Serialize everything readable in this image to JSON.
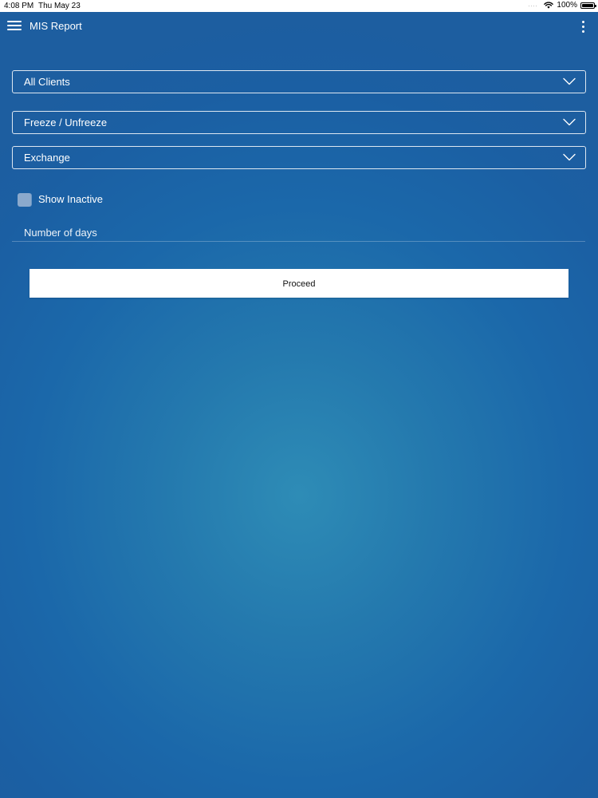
{
  "status_bar": {
    "time": "4:08 PM",
    "date": "Thu May 23",
    "signal_dots": "....",
    "battery": "100%",
    "battery_level": 1.0,
    "wifi_icon": "wifi-icon"
  },
  "app_bar": {
    "title": "MIS Report",
    "menu_icon": "hamburger-menu-icon",
    "more_icon": "more-vertical-icon"
  },
  "form": {
    "clients_dropdown": {
      "selected": "All Clients",
      "icon": "chevron-down-icon"
    },
    "freeze_dropdown": {
      "selected": "Freeze / Unfreeze",
      "icon": "chevron-down-icon"
    },
    "exchange_dropdown": {
      "selected": "Exchange",
      "icon": "chevron-down-icon"
    },
    "show_inactive": {
      "label": "Show Inactive",
      "checked": false
    },
    "days_field": {
      "placeholder": "Number of days",
      "value": ""
    },
    "proceed_label": "Proceed"
  },
  "colors": {
    "background_center": "#2e8cb6",
    "background_edge": "#1b5fa3",
    "text": "#ffffff",
    "button_bg": "#ffffff",
    "checkbox_bg": "#8ba9cc"
  }
}
